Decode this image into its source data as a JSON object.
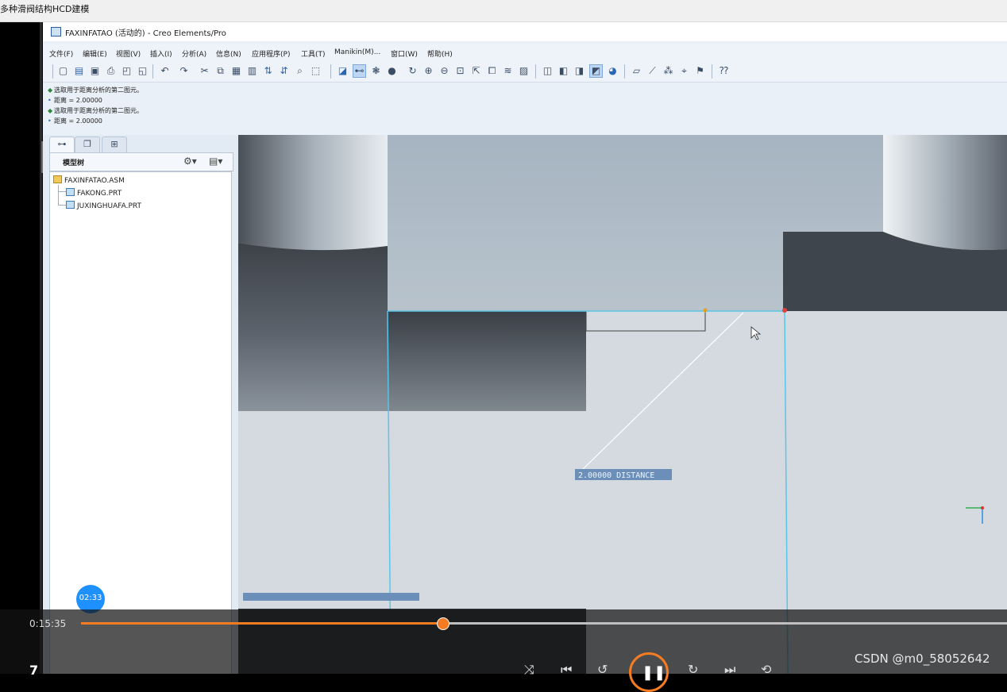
{
  "page_tab": "多种滑阀结构HCD建模",
  "window": {
    "title": "FAXINFATAO (活动的) - Creo Elements/Pro"
  },
  "menu": [
    "文件(F)",
    "编辑(E)",
    "视图(V)",
    "插入(I)",
    "分析(A)",
    "信息(N)",
    "应用程序(P)",
    "工具(T)",
    "Manikin(M)...",
    "窗口(W)",
    "帮助(H)"
  ],
  "messages": [
    {
      "type": "prompt",
      "text": "选取用于距离分析的第二图元。"
    },
    {
      "type": "info",
      "text": "距离 = 2.00000"
    },
    {
      "type": "prompt",
      "text": "选取用于距离分析的第二图元。"
    },
    {
      "type": "info",
      "text": "距离 = 2.00000"
    }
  ],
  "model_tree": {
    "header": "模型树",
    "items": [
      {
        "label": "FAXINFATAO.ASM",
        "kind": "assembly"
      },
      {
        "label": "FAKONG.PRT",
        "kind": "part"
      },
      {
        "label": "JUXINGHUAFA.PRT",
        "kind": "part"
      }
    ]
  },
  "viewport": {
    "dimension_label": "2.00000  DISTANCE"
  },
  "video_player": {
    "chapter_badge": "02:33",
    "current_time": "0:15:35",
    "progress_fraction": 0.39,
    "episode_number": "7",
    "accent_color": "#f57c22"
  },
  "watermark": "CSDN @m0_58052642"
}
